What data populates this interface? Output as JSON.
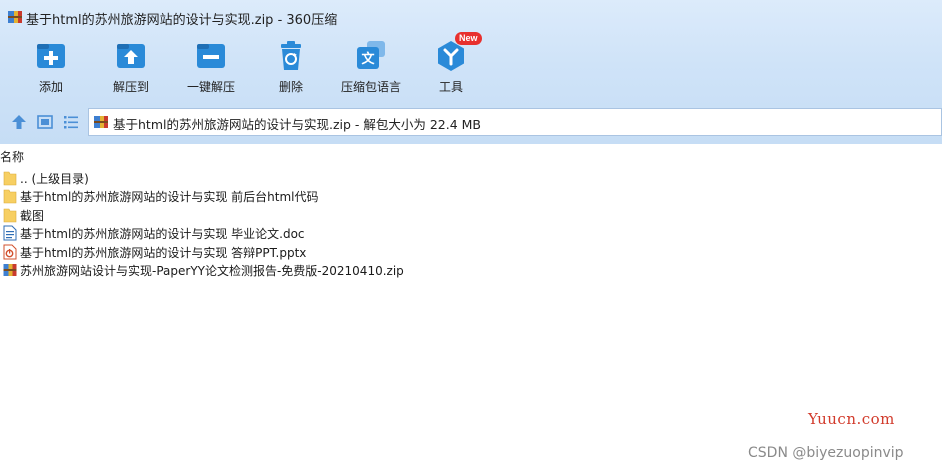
{
  "window": {
    "title": "基于html的苏州旅游网站的设计与实现.zip - 360压缩",
    "app_icon": "archive-icon"
  },
  "toolbar": {
    "items": [
      {
        "label": "添加",
        "icon": "add-icon"
      },
      {
        "label": "解压到",
        "icon": "extract-to-icon"
      },
      {
        "label": "一键解压",
        "icon": "one-click-extract-icon"
      },
      {
        "label": "删除",
        "icon": "recycle-bin-icon"
      },
      {
        "label": "压缩包语言",
        "icon": "language-icon"
      },
      {
        "label": "工具",
        "icon": "tools-icon",
        "badge": "New"
      }
    ]
  },
  "nav": {
    "path_text": "基于html的苏州旅游网站的设计与实现.zip - 解包大小为 22.4 MB"
  },
  "list": {
    "column_name": "名称",
    "items": [
      {
        "name": ".. (上级目录)",
        "type": "folder"
      },
      {
        "name": "基于html的苏州旅游网站的设计与实现 前后台html代码",
        "type": "folder"
      },
      {
        "name": "截图",
        "type": "folder"
      },
      {
        "name": "基于html的苏州旅游网站的设计与实现 毕业论文.doc",
        "type": "doc"
      },
      {
        "name": "基于html的苏州旅游网站的设计与实现 答辩PPT.pptx",
        "type": "ppt"
      },
      {
        "name": "苏州旅游网站设计与实现-PaperYY论文检测报告-免费版-20210410.zip",
        "type": "zip"
      }
    ]
  },
  "watermarks": {
    "site": "Yuucn.com",
    "csdn": "CSDN @biyezuopinvip"
  },
  "colors": {
    "accent": "#2a8ad8",
    "folder": "#f7cf62",
    "badge": "#e8302e"
  }
}
